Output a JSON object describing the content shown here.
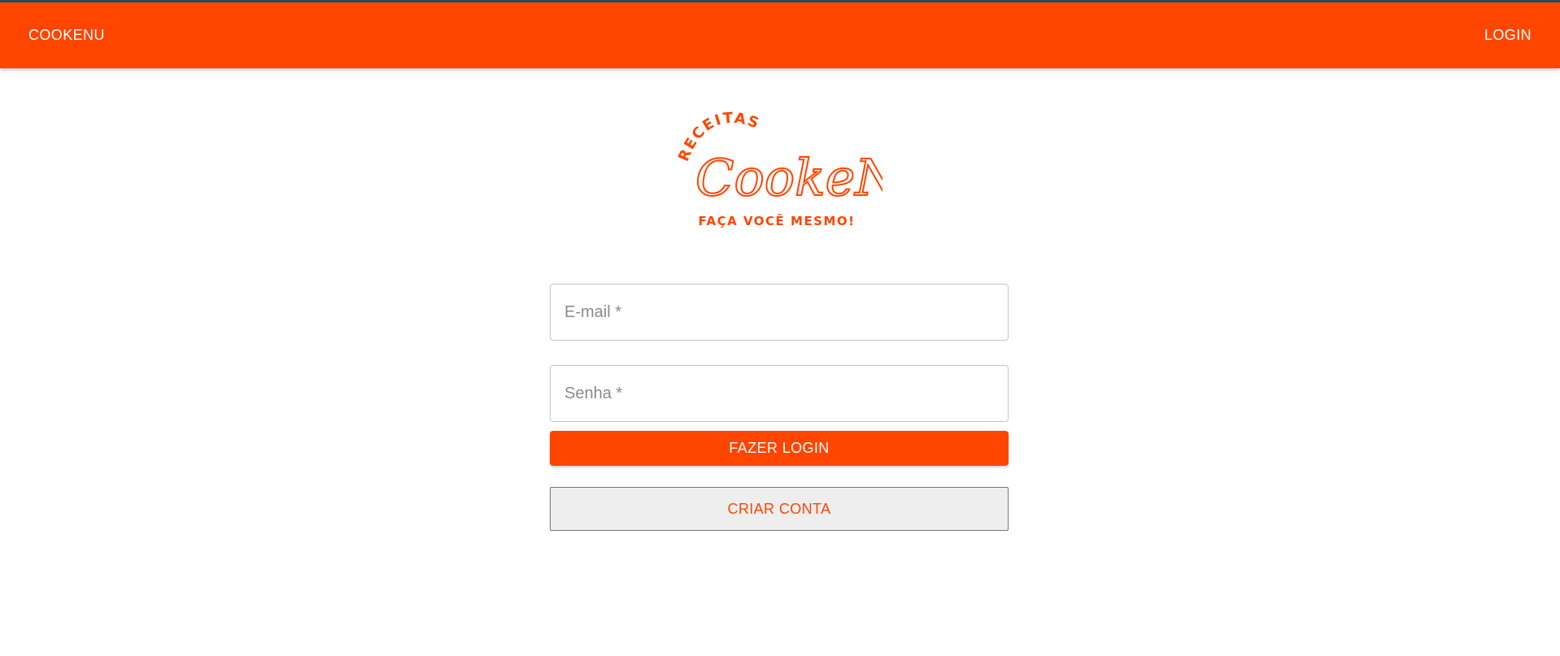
{
  "appbar": {
    "brand_label": "COOKENU",
    "login_label": "LOGIN"
  },
  "logo": {
    "top_text": "RECEITAS",
    "script_text": "CookeNu",
    "tagline": "FAÇA VOCÊ MESMO!",
    "color": "#ff4500"
  },
  "form": {
    "email_placeholder": "E-mail *",
    "email_value": "",
    "password_placeholder": "Senha *",
    "password_value": "",
    "login_button_label": "FAZER LOGIN",
    "signup_button_label": "CRIAR CONTA"
  },
  "colors": {
    "primary": "#ff4500",
    "topline": "#1f4e5a",
    "background": "#ffffff",
    "secondary_button_bg": "#eeeeee"
  }
}
